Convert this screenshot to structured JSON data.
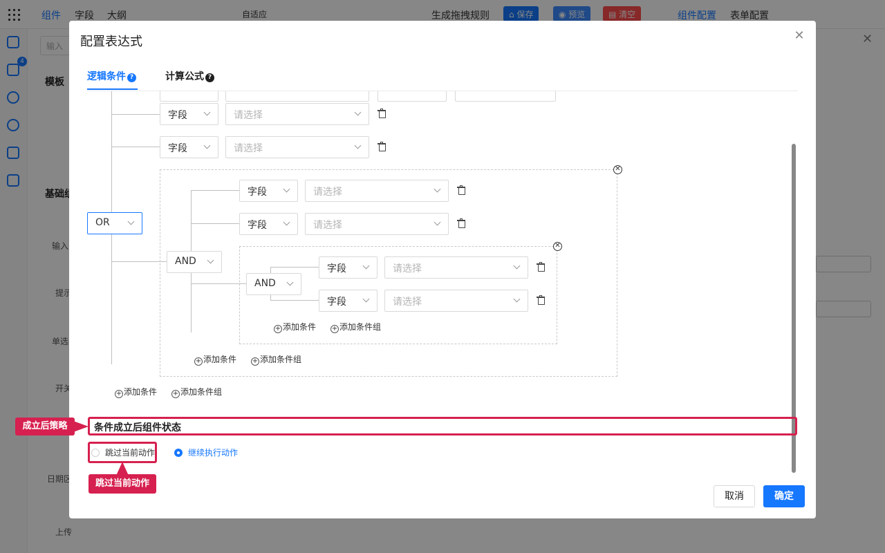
{
  "background": {
    "topbar": {
      "left_tabs": [
        "组件",
        "字段",
        "大纲"
      ],
      "mode": "自适应",
      "generate_rule": "生成拖拽规则",
      "save": "保存",
      "preview": "预览",
      "clear": "清空",
      "right_tabs": [
        "组件配置",
        "表单配置"
      ]
    },
    "sidebar": {
      "search_placeholder": "输入",
      "section_template": "模板",
      "section_basic": "基础组",
      "items": [
        "输入",
        "提示",
        "单选",
        "开关",
        "日期区",
        "上传"
      ]
    },
    "rail_badge": "4"
  },
  "modal": {
    "title": "配置表达式",
    "tabs": [
      {
        "label": "逻辑条件",
        "help": "?"
      },
      {
        "label": "计算公式",
        "help": "?"
      }
    ],
    "rows": {
      "field_label": "字段",
      "value_placeholder": "请选择"
    },
    "root_logic": "OR",
    "group1_logic": "AND",
    "group2_logic": "AND",
    "add_condition": "添加条件",
    "add_group": "添加条件组",
    "strategy_title": "条件成立后组件状态",
    "radios": [
      {
        "label": "跳过当前动作",
        "checked": false
      },
      {
        "label": "继续执行动作",
        "checked": true
      }
    ],
    "cancel": "取消",
    "confirm": "确定"
  },
  "annotations": {
    "strategy_tag": "成立后策略",
    "skip_tag": "跳过当前动作"
  },
  "colors": {
    "primary": "#1677ff",
    "annotation": "#d6204f"
  }
}
